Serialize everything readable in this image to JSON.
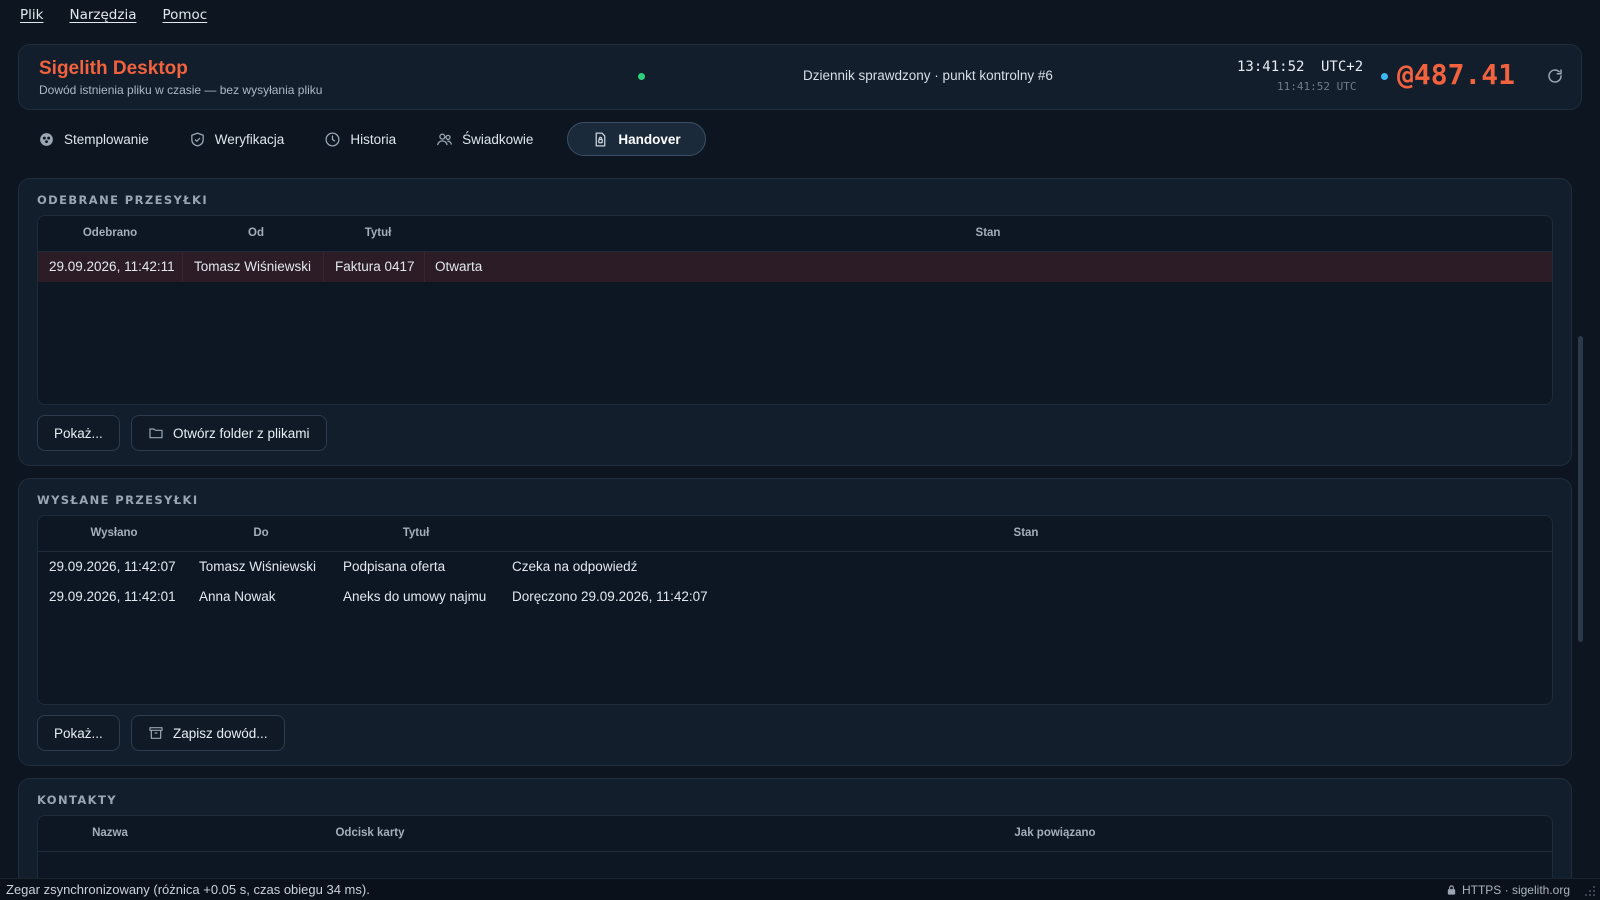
{
  "menu": {
    "file": "Plik",
    "tools": "Narzędzia",
    "help": "Pomoc"
  },
  "header": {
    "title": "Sigelith Desktop",
    "subtitle": "Dowód istnienia pliku w czasie — bez wysyłania pliku",
    "journal_status": "Dziennik sprawdzony · punkt kontrolny #6",
    "clock_local": "13:41:52",
    "clock_tz": "UTC+2",
    "clock_utc": "11:41:52 UTC",
    "balance": "@487.41",
    "status_dot_color": "#2fd07e",
    "sync_dot_color": "#3eb8f5"
  },
  "tabs": [
    {
      "label": "Stemplowanie",
      "icon": "stamp-icon"
    },
    {
      "label": "Weryfikacja",
      "icon": "shield-check-icon"
    },
    {
      "label": "Historia",
      "icon": "clock-icon"
    },
    {
      "label": "Świadkowie",
      "icon": "users-icon"
    },
    {
      "label": "Handover",
      "icon": "document-lock-icon",
      "active": true
    }
  ],
  "received": {
    "title": "ODEBRANE PRZESYŁKI",
    "columns": [
      "Odebrano",
      "Od",
      "Tytuł",
      "Stan"
    ],
    "rows": [
      {
        "date": "29.09.2026, 11:42:11",
        "from": "Tomasz Wiśniewski",
        "title": "Faktura 0417",
        "state": "Otwarta"
      }
    ],
    "show_button": "Pokaż...",
    "folder_button": "Otwórz folder z plikami"
  },
  "sent": {
    "title": "WYSŁANE PRZESYŁKI",
    "columns": [
      "Wysłano",
      "Do",
      "Tytuł",
      "Stan"
    ],
    "rows": [
      {
        "date": "29.09.2026, 11:42:07",
        "to": "Tomasz Wiśniewski",
        "title": "Podpisana oferta",
        "state": "Czeka na odpowiedź"
      },
      {
        "date": "29.09.2026, 11:42:01",
        "to": "Anna Nowak",
        "title": "Aneks do umowy najmu",
        "state": "Doręczono 29.09.2026, 11:42:07"
      }
    ],
    "show_button": "Pokaż...",
    "save_button": "Zapisz dowód..."
  },
  "contacts": {
    "title": "KONTAKTY",
    "columns": [
      "Nazwa",
      "Odcisk karty",
      "Jak powiązano"
    ]
  },
  "statusbar": {
    "left": "Zegar zsynchronizowany (różnica +0.05 s, czas obiegu 34 ms).",
    "right": "HTTPS · sigelith.org"
  },
  "colors": {
    "accent": "#f2623e",
    "bg": "#0c1520",
    "panel": "#121e2b",
    "selected_row": "#2b1c26"
  }
}
